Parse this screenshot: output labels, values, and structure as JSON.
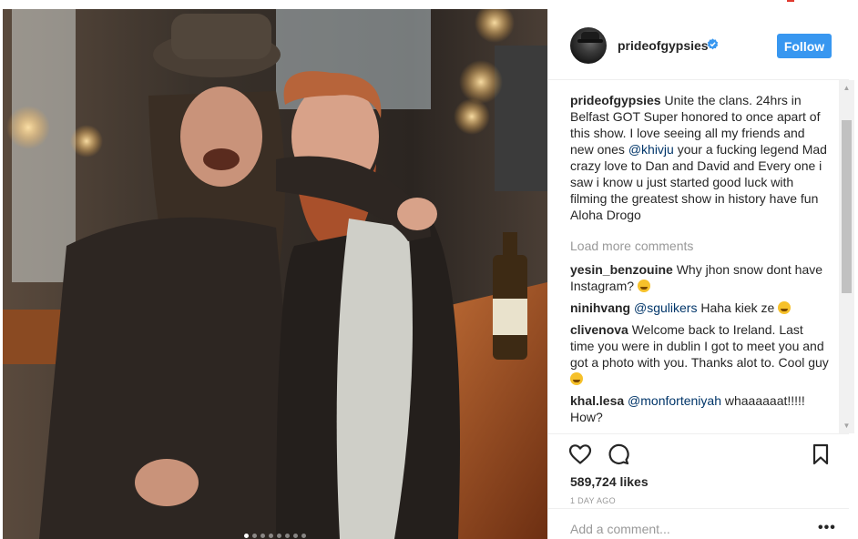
{
  "post": {
    "username": "prideofgypsies",
    "follow_label": "Follow",
    "likes": "589,724 likes",
    "date": "1 DAY AGO",
    "load_more": "Load more comments",
    "add_comment_placeholder": "Add a comment...",
    "more_options": "•••",
    "carousel": {
      "count": 8,
      "active": 0
    }
  },
  "caption": {
    "user": "prideofgypsies",
    "text_1": "Unite the clans. 24hrs in Belfast GOT Super honored to once apart of this show. I love seeing all my friends and new ones ",
    "mention": "@khivju",
    "text_2": " your a fucking legend Mad crazy love to Dan and David and Every one i saw i know u just started good luck with filming the greatest show in history have fun Aloha Drogo"
  },
  "comments": [
    {
      "user": "yesin_benzouine",
      "mention": "",
      "text": "Why jhon snow dont have Instagram? ",
      "emoji": "grinning-sweat-emoji"
    },
    {
      "user": "ninihvang",
      "mention": "@sgulikers",
      "text": " Haha kiek ze ",
      "emoji": "laughing-emoji"
    },
    {
      "user": "clivenova",
      "mention": "",
      "text": "Welcome back to Ireland. Last time you were in dublin I got to meet you and got a photo with you. Thanks alot to. Cool guy ",
      "emoji": "smiling-emoji"
    },
    {
      "user": "khal.lesa",
      "mention": "@monforteniyah",
      "text": " whaaaaaat!!!!! How?",
      "emoji": ""
    }
  ],
  "colors": {
    "accent": "#3897f0",
    "mention": "#003569",
    "muted": "#999999",
    "verified": "#3897f0"
  },
  "icons": [
    "verified-badge-icon",
    "heart-icon",
    "comment-icon",
    "bookmark-icon",
    "more-options-icon"
  ]
}
